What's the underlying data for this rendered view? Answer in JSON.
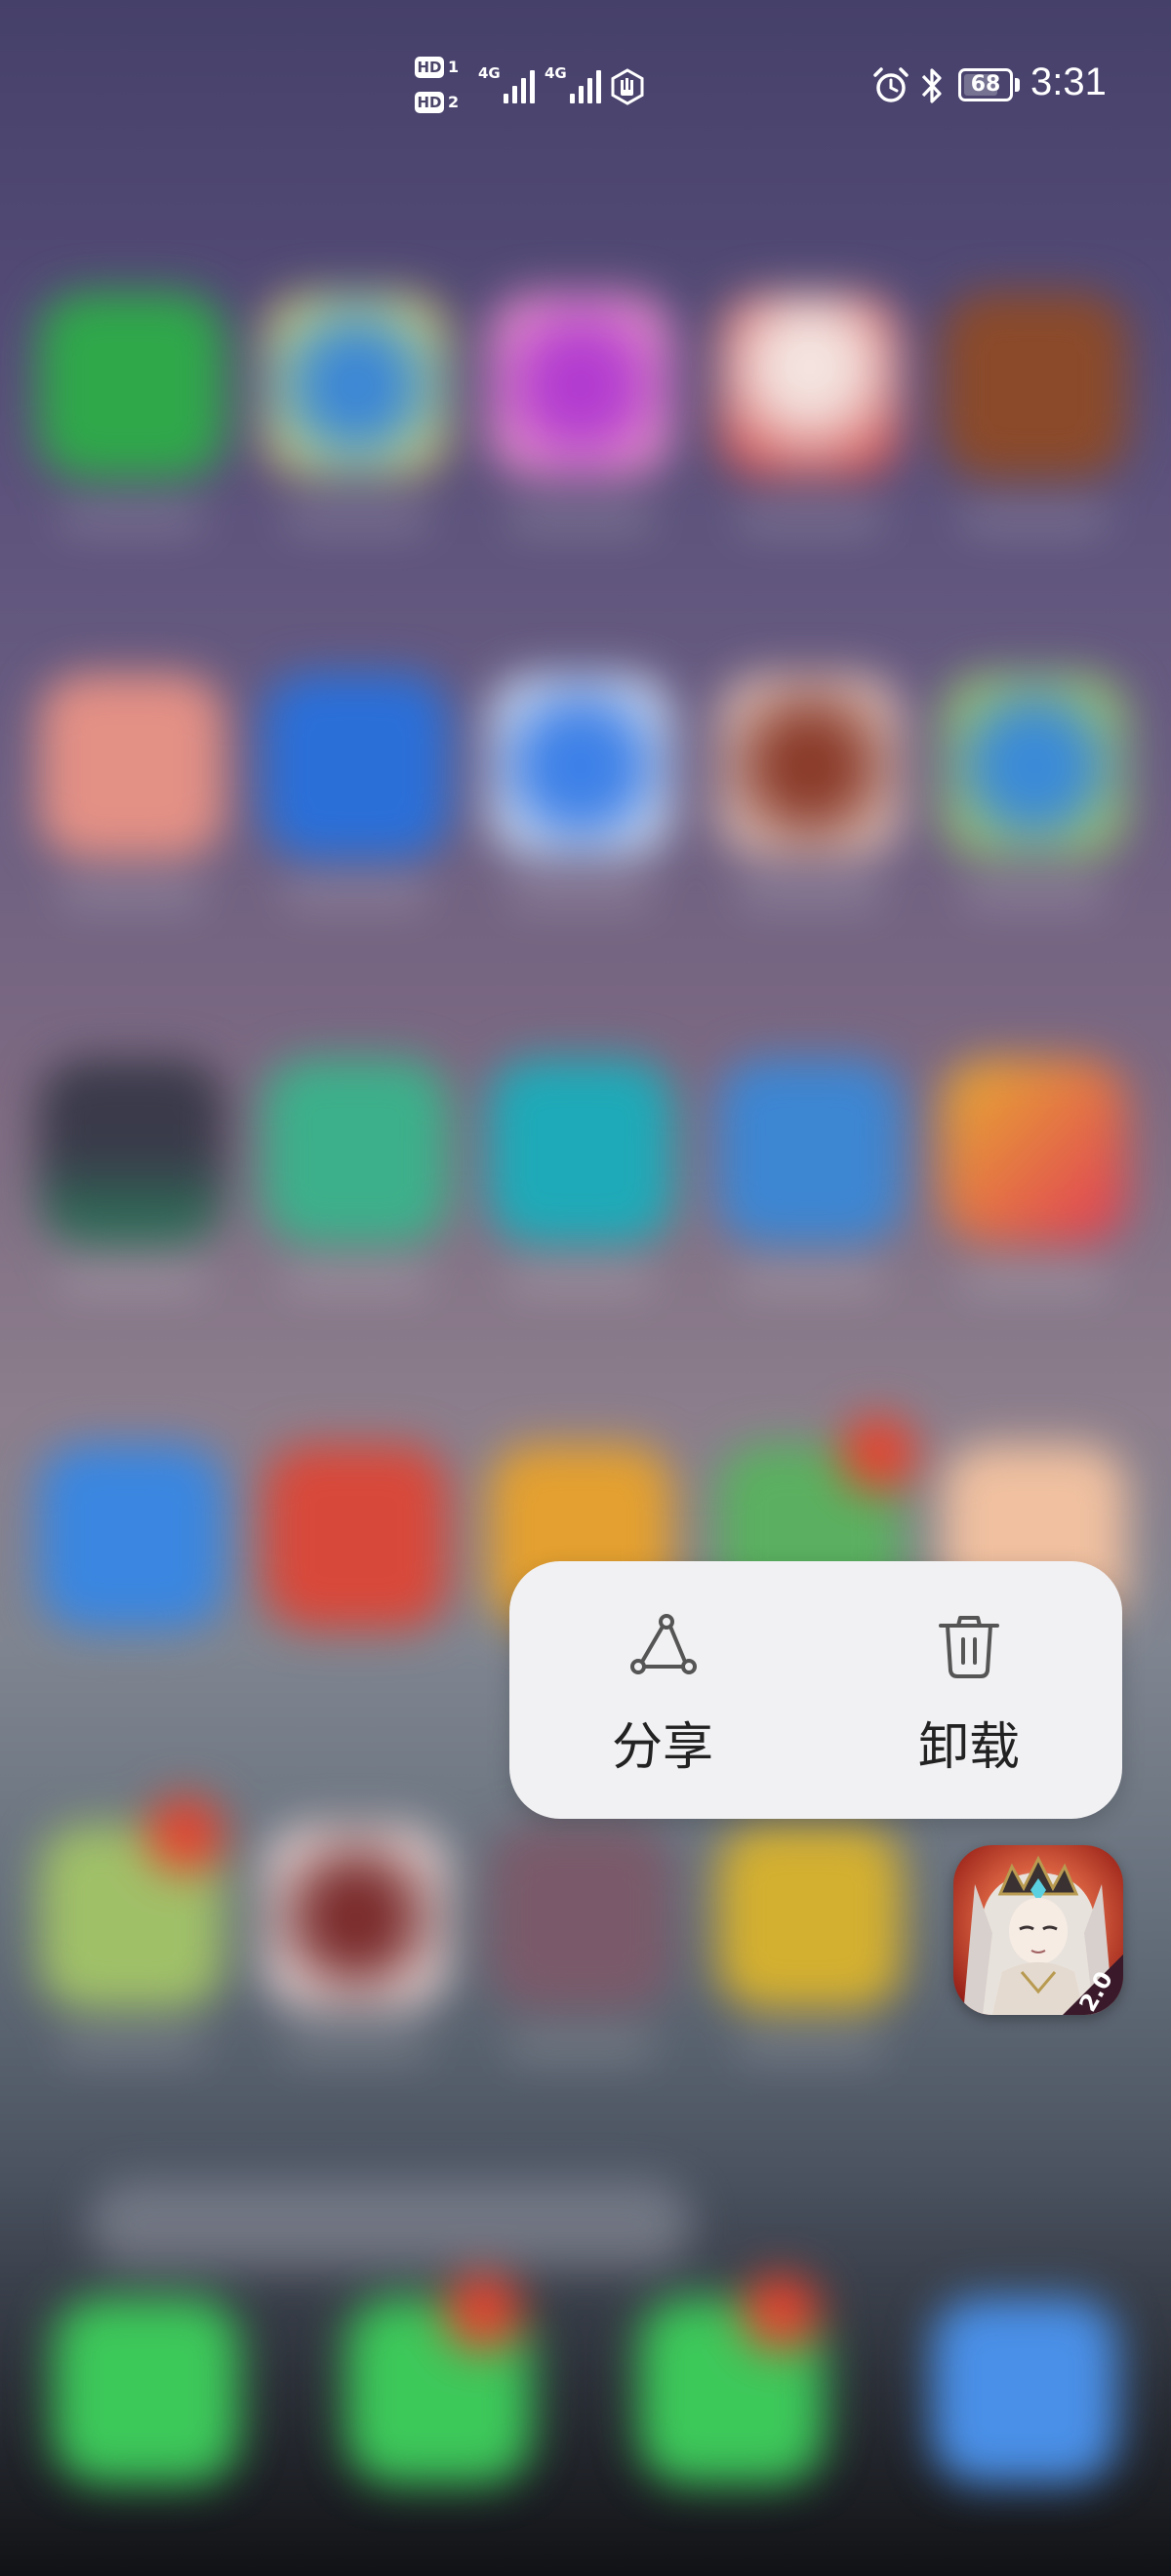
{
  "status_bar": {
    "sim1_label": "HD",
    "sim1_num": "1",
    "sim2_label": "HD",
    "sim2_num": "2",
    "network1": "4G",
    "network2": "4G",
    "battery_level": "68",
    "time": "3:31",
    "icons": [
      "hd-sim-icon",
      "signal-icon",
      "signal-icon",
      "hotspot-icon",
      "alarm-icon",
      "bluetooth-icon",
      "battery-icon"
    ]
  },
  "context_menu": {
    "share_label": "分享",
    "uninstall_label": "卸载",
    "share_icon": "share-icon",
    "uninstall_icon": "trash-icon"
  },
  "selected_app": {
    "icon": "game-app-icon",
    "badge": "2.0",
    "accent": "#c0261d"
  },
  "colors": {
    "menu_background": "#f1f1f3",
    "menu_text": "#222222"
  }
}
